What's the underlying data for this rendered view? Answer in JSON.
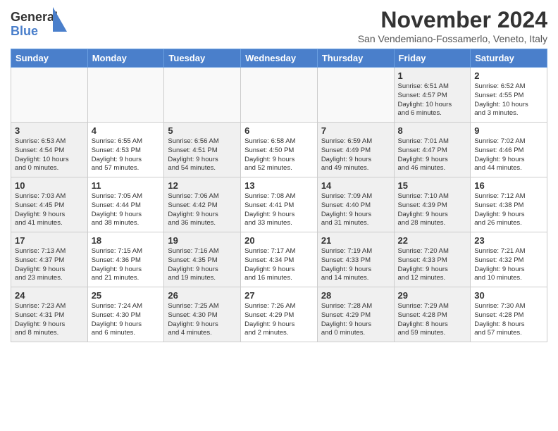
{
  "header": {
    "logo_general": "General",
    "logo_blue": "Blue",
    "month_title": "November 2024",
    "location": "San Vendemiano-Fossamerlo, Veneto, Italy"
  },
  "days_of_week": [
    "Sunday",
    "Monday",
    "Tuesday",
    "Wednesday",
    "Thursday",
    "Friday",
    "Saturday"
  ],
  "weeks": [
    [
      {
        "day": "",
        "info": "",
        "empty": true
      },
      {
        "day": "",
        "info": "",
        "empty": true
      },
      {
        "day": "",
        "info": "",
        "empty": true
      },
      {
        "day": "",
        "info": "",
        "empty": true
      },
      {
        "day": "",
        "info": "",
        "empty": true
      },
      {
        "day": "1",
        "info": "Sunrise: 6:51 AM\nSunset: 4:57 PM\nDaylight: 10 hours\nand 6 minutes.",
        "shaded": true
      },
      {
        "day": "2",
        "info": "Sunrise: 6:52 AM\nSunset: 4:55 PM\nDaylight: 10 hours\nand 3 minutes."
      }
    ],
    [
      {
        "day": "3",
        "info": "Sunrise: 6:53 AM\nSunset: 4:54 PM\nDaylight: 10 hours\nand 0 minutes.",
        "shaded": true
      },
      {
        "day": "4",
        "info": "Sunrise: 6:55 AM\nSunset: 4:53 PM\nDaylight: 9 hours\nand 57 minutes."
      },
      {
        "day": "5",
        "info": "Sunrise: 6:56 AM\nSunset: 4:51 PM\nDaylight: 9 hours\nand 54 minutes.",
        "shaded": true
      },
      {
        "day": "6",
        "info": "Sunrise: 6:58 AM\nSunset: 4:50 PM\nDaylight: 9 hours\nand 52 minutes."
      },
      {
        "day": "7",
        "info": "Sunrise: 6:59 AM\nSunset: 4:49 PM\nDaylight: 9 hours\nand 49 minutes.",
        "shaded": true
      },
      {
        "day": "8",
        "info": "Sunrise: 7:01 AM\nSunset: 4:47 PM\nDaylight: 9 hours\nand 46 minutes.",
        "shaded": true
      },
      {
        "day": "9",
        "info": "Sunrise: 7:02 AM\nSunset: 4:46 PM\nDaylight: 9 hours\nand 44 minutes."
      }
    ],
    [
      {
        "day": "10",
        "info": "Sunrise: 7:03 AM\nSunset: 4:45 PM\nDaylight: 9 hours\nand 41 minutes.",
        "shaded": true
      },
      {
        "day": "11",
        "info": "Sunrise: 7:05 AM\nSunset: 4:44 PM\nDaylight: 9 hours\nand 38 minutes."
      },
      {
        "day": "12",
        "info": "Sunrise: 7:06 AM\nSunset: 4:42 PM\nDaylight: 9 hours\nand 36 minutes.",
        "shaded": true
      },
      {
        "day": "13",
        "info": "Sunrise: 7:08 AM\nSunset: 4:41 PM\nDaylight: 9 hours\nand 33 minutes."
      },
      {
        "day": "14",
        "info": "Sunrise: 7:09 AM\nSunset: 4:40 PM\nDaylight: 9 hours\nand 31 minutes.",
        "shaded": true
      },
      {
        "day": "15",
        "info": "Sunrise: 7:10 AM\nSunset: 4:39 PM\nDaylight: 9 hours\nand 28 minutes.",
        "shaded": true
      },
      {
        "day": "16",
        "info": "Sunrise: 7:12 AM\nSunset: 4:38 PM\nDaylight: 9 hours\nand 26 minutes."
      }
    ],
    [
      {
        "day": "17",
        "info": "Sunrise: 7:13 AM\nSunset: 4:37 PM\nDaylight: 9 hours\nand 23 minutes.",
        "shaded": true
      },
      {
        "day": "18",
        "info": "Sunrise: 7:15 AM\nSunset: 4:36 PM\nDaylight: 9 hours\nand 21 minutes."
      },
      {
        "day": "19",
        "info": "Sunrise: 7:16 AM\nSunset: 4:35 PM\nDaylight: 9 hours\nand 19 minutes.",
        "shaded": true
      },
      {
        "day": "20",
        "info": "Sunrise: 7:17 AM\nSunset: 4:34 PM\nDaylight: 9 hours\nand 16 minutes."
      },
      {
        "day": "21",
        "info": "Sunrise: 7:19 AM\nSunset: 4:33 PM\nDaylight: 9 hours\nand 14 minutes.",
        "shaded": true
      },
      {
        "day": "22",
        "info": "Sunrise: 7:20 AM\nSunset: 4:33 PM\nDaylight: 9 hours\nand 12 minutes.",
        "shaded": true
      },
      {
        "day": "23",
        "info": "Sunrise: 7:21 AM\nSunset: 4:32 PM\nDaylight: 9 hours\nand 10 minutes."
      }
    ],
    [
      {
        "day": "24",
        "info": "Sunrise: 7:23 AM\nSunset: 4:31 PM\nDaylight: 9 hours\nand 8 minutes.",
        "shaded": true
      },
      {
        "day": "25",
        "info": "Sunrise: 7:24 AM\nSunset: 4:30 PM\nDaylight: 9 hours\nand 6 minutes."
      },
      {
        "day": "26",
        "info": "Sunrise: 7:25 AM\nSunset: 4:30 PM\nDaylight: 9 hours\nand 4 minutes.",
        "shaded": true
      },
      {
        "day": "27",
        "info": "Sunrise: 7:26 AM\nSunset: 4:29 PM\nDaylight: 9 hours\nand 2 minutes."
      },
      {
        "day": "28",
        "info": "Sunrise: 7:28 AM\nSunset: 4:29 PM\nDaylight: 9 hours\nand 0 minutes.",
        "shaded": true
      },
      {
        "day": "29",
        "info": "Sunrise: 7:29 AM\nSunset: 4:28 PM\nDaylight: 8 hours\nand 59 minutes.",
        "shaded": true
      },
      {
        "day": "30",
        "info": "Sunrise: 7:30 AM\nSunset: 4:28 PM\nDaylight: 8 hours\nand 57 minutes."
      }
    ]
  ]
}
